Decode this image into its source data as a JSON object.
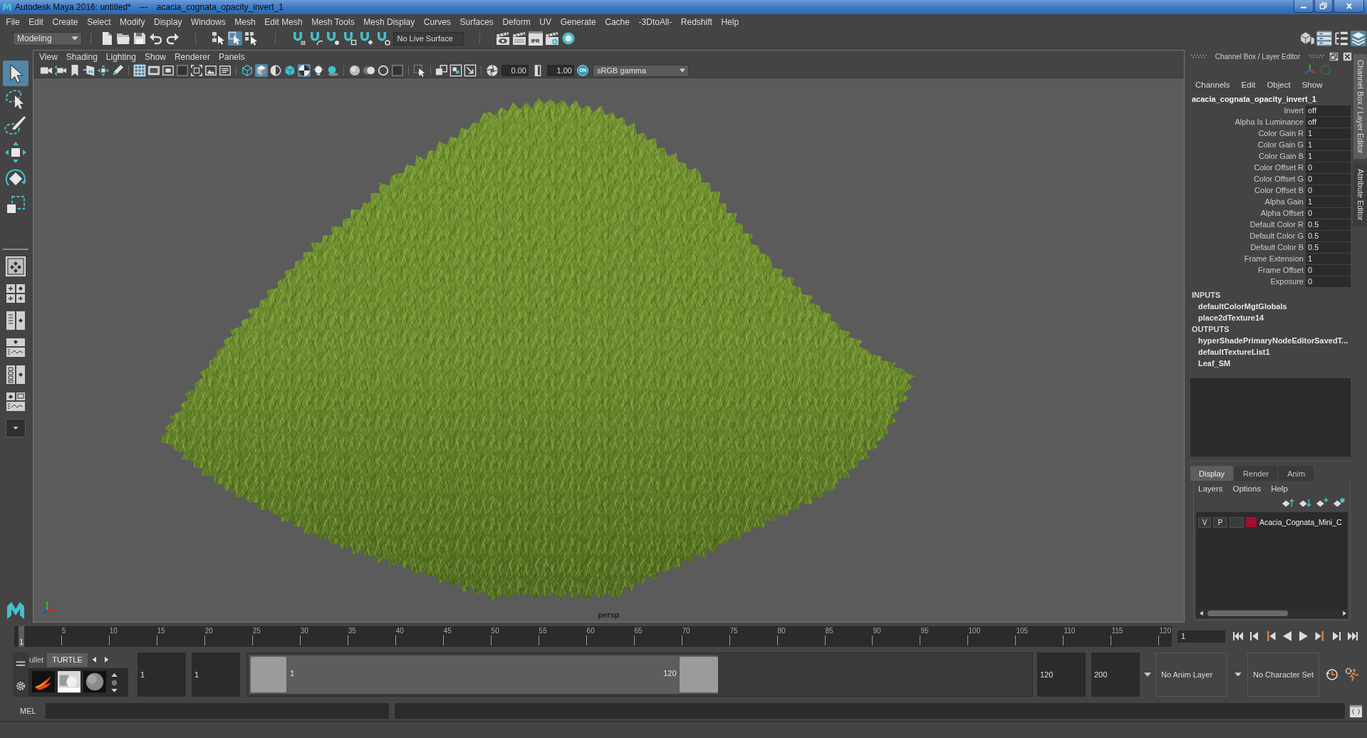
{
  "window": {
    "title": "Autodesk Maya 2016: untitled*",
    "separator": "---",
    "scene": "acacia_cognata_opacity_invert_1"
  },
  "menu_bar": [
    "File",
    "Edit",
    "Create",
    "Select",
    "Modify",
    "Display",
    "Windows",
    "Mesh",
    "Edit Mesh",
    "Mesh Tools",
    "Mesh Display",
    "Curves",
    "Surfaces",
    "Deform",
    "UV",
    "Generate",
    "Cache",
    "-3DtoAll-",
    "Redshift",
    "Help"
  ],
  "status_line": {
    "menu_set": "Modeling",
    "selection_modes": [
      {
        "selected": false
      },
      {
        "selected": true
      },
      {
        "selected": false
      }
    ],
    "live_surface": "No Live Surface",
    "ipr": "IPR",
    "panel_toggles": [
      {
        "on": false
      },
      {
        "on": true
      },
      {
        "on": false
      },
      {
        "on": true
      }
    ]
  },
  "toolbox": {
    "tools": [
      {
        "selected": true
      },
      {
        "selected": false
      },
      {
        "selected": false
      },
      {
        "selected": false
      },
      {
        "selected": false
      },
      {
        "selected": false
      }
    ]
  },
  "viewport": {
    "menu": [
      "View",
      "Shading",
      "Lighting",
      "Show",
      "Renderer",
      "Panels"
    ],
    "toggles": [
      {
        "on": false
      },
      {
        "on": false
      },
      {
        "on": false
      },
      {
        "on": false
      },
      {
        "on": false
      },
      {
        "on": false
      },
      {
        "on": true
      },
      {
        "on": false
      },
      {
        "on": false
      },
      {
        "on": false
      },
      {
        "on": false
      },
      {
        "on": false
      },
      {
        "on": false
      },
      {
        "on": false
      },
      {
        "on": true
      },
      {
        "on": false
      },
      {
        "on": false
      },
      {
        "on": true
      },
      {
        "on": false
      },
      {
        "on": false
      },
      {
        "on": false
      },
      {
        "on": false
      },
      {
        "on": false
      },
      {
        "on": false
      },
      {
        "on": false
      },
      {
        "on": false
      },
      {
        "on": false
      },
      {
        "on": false
      }
    ],
    "exposure": "0.00",
    "gamma": "1.00",
    "color_management": "ON",
    "view_transform": "sRGB gamma",
    "camera": "persp"
  },
  "channel_box": {
    "title": "Channel Box / Layer Editor",
    "menu": [
      "Channels",
      "Edit",
      "Object",
      "Show"
    ],
    "node": "acacia_cognata_opacity_invert_1",
    "attributes": [
      {
        "name": "Invert",
        "value": "off"
      },
      {
        "name": "Alpha Is Luminance",
        "value": "off"
      },
      {
        "name": "Color Gain R",
        "value": "1"
      },
      {
        "name": "Color Gain G",
        "value": "1"
      },
      {
        "name": "Color Gain B",
        "value": "1"
      },
      {
        "name": "Color Offset R",
        "value": "0"
      },
      {
        "name": "Color Offset G",
        "value": "0"
      },
      {
        "name": "Color Offset B",
        "value": "0"
      },
      {
        "name": "Alpha Gain",
        "value": "1"
      },
      {
        "name": "Alpha Offset",
        "value": "0"
      },
      {
        "name": "Default Color R",
        "value": "0.5"
      },
      {
        "name": "Default Color G",
        "value": "0.5"
      },
      {
        "name": "Default Color B",
        "value": "0.5"
      },
      {
        "name": "Frame Extension",
        "value": "1"
      },
      {
        "name": "Frame Offset",
        "value": "0"
      },
      {
        "name": "Exposure",
        "value": "0"
      }
    ],
    "inputs_heading": "INPUTS",
    "inputs": [
      "defaultColorMgtGlobals",
      "place2dTexture14"
    ],
    "outputs_heading": "OUTPUTS",
    "outputs": [
      "hyperShadePrimaryNodeEditorSavedT...",
      "defaultTextureList1",
      "Leaf_SM"
    ]
  },
  "layer_editor": {
    "tabs": [
      {
        "label": "Display",
        "selected": true
      },
      {
        "label": "Render",
        "selected": false
      },
      {
        "label": "Anim",
        "selected": false
      }
    ],
    "menu": [
      "Layers",
      "Options",
      "Help"
    ],
    "layers": [
      {
        "visibility": "V",
        "playback": "P",
        "name": "Acacia_Cognata_Mini_C",
        "color": "#a0102e"
      }
    ]
  },
  "side_tabs": [
    {
      "label": "Channel Box / Layer Editor",
      "selected": true
    },
    {
      "label": "Attribute Editor",
      "selected": false
    }
  ],
  "time_slider": {
    "ticks": [
      "5",
      "10",
      "15",
      "20",
      "25",
      "30",
      "35",
      "40",
      "45",
      "50",
      "55",
      "60",
      "65",
      "70",
      "75",
      "80",
      "85",
      "90",
      "95",
      "100",
      "105",
      "110",
      "115",
      "120"
    ],
    "current_frame": "1",
    "frame_field": "1"
  },
  "range_slider": {
    "shelf_tabs": [
      {
        "label": "ullet",
        "selected": false
      },
      {
        "label": "TURTLE",
        "selected": true
      }
    ],
    "start": "1",
    "range_start": "1",
    "range_start_label": "1",
    "range_end_label": "120",
    "range_end": "120",
    "end": "200",
    "level": 0.6,
    "anim_layer": "No Anim Layer",
    "character_set": "No Character Set"
  },
  "command_line": {
    "language": "MEL"
  }
}
